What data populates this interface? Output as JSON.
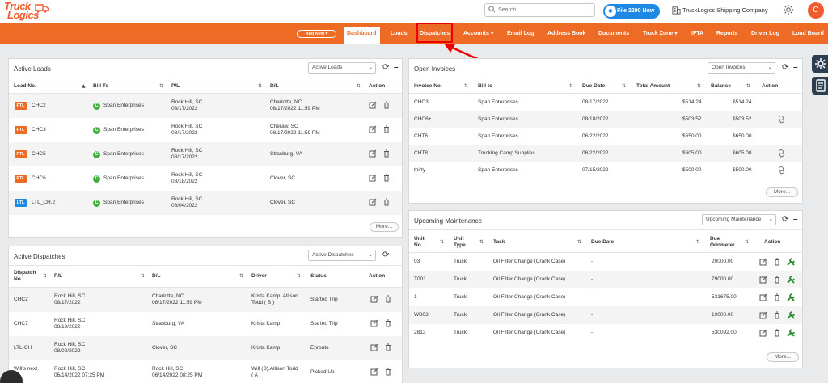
{
  "header": {
    "logo_line1": "Truck",
    "logo_line2": "Logics",
    "search_placeholder": "Search",
    "file_button": "File 2290 Now",
    "company_name": "TruckLogics Shipping Company",
    "avatar_initial": "C"
  },
  "nav": {
    "add_new": "Add New",
    "items": [
      "Dashboard",
      "Loads",
      "Dispatches",
      "Accounts",
      "Email Log",
      "Address Book",
      "Documents",
      "Truck Zone",
      "IFTA",
      "Reports",
      "Driver Log",
      "Load Board"
    ],
    "active": "Dashboard",
    "highlighted": "Dispatches"
  },
  "active_loads": {
    "title": "Active Loads",
    "select": "Active Loads",
    "columns": [
      "Load No.",
      "Bill To",
      "P/L",
      "D/L",
      "Action"
    ],
    "rows": [
      {
        "type": "FTL",
        "load": "CHC2",
        "bill_to": "Span Enterprises",
        "pl_city": "Rock Hill, SC",
        "pl_date": "08/17/2022",
        "dl_city": "Charlotte, NC",
        "dl_date": "08/17/2022 11:59 PM"
      },
      {
        "type": "FTL",
        "load": "CHC3",
        "bill_to": "Span Enterprises",
        "pl_city": "Rock Hill, SC",
        "pl_date": "08/17/2022",
        "dl_city": "Cheraw, SC",
        "dl_date": "08/17/2022 11:59 PM"
      },
      {
        "type": "FTL",
        "load": "CHC5",
        "bill_to": "Span Enterprises",
        "pl_city": "Rock Hill, SC",
        "pl_date": "08/17/2022",
        "dl_city": "Strasburg, VA",
        "dl_date": ""
      },
      {
        "type": "FTL",
        "load": "CHC6",
        "bill_to": "Span Enterprises",
        "pl_city": "Rock Hill, SC",
        "pl_date": "08/18/2022",
        "dl_city": "Clover, SC",
        "dl_date": ""
      },
      {
        "type": "LTL",
        "load": "LTL_CH.2",
        "bill_to": "Span Enterprises",
        "pl_city": "Rock Hill, SC",
        "pl_date": "08/04/2022",
        "dl_city": "Clover, SC",
        "dl_date": ""
      }
    ],
    "more": "More..."
  },
  "active_dispatches": {
    "title": "Active Dispatches",
    "select": "Active Dispatches",
    "columns": [
      "Dispatch No.",
      "P/L",
      "D/L",
      "Driver",
      "Status",
      "Action"
    ],
    "rows": [
      {
        "no": "CHC2",
        "pl_city": "Rock Hill, SC",
        "pl_date": "08/17/2022",
        "dl_city": "Charlotte, NC",
        "dl_date": "08/17/2022 11:59 PM",
        "driver1": "Krista Kamp, Allison",
        "driver2": "Todd ( B )",
        "status": "Started Trip"
      },
      {
        "no": "CHC7",
        "pl_city": "Rock Hill, SC",
        "pl_date": "08/19/2022",
        "dl_city": "Strasburg, VA",
        "dl_date": "",
        "driver1": "Krista Kamp",
        "driver2": "",
        "status": "Started Trip"
      },
      {
        "no": "LTL-CH",
        "pl_city": "Rock Hill, SC",
        "pl_date": "08/02/2022",
        "dl_city": "Clover, SC",
        "dl_date": "",
        "driver1": "Krista Kamp",
        "driver2": "",
        "status": "Enroute"
      },
      {
        "no": "Will's next",
        "pl_city": "Rock Hill, SC",
        "pl_date": "06/14/2022 07:25 PM",
        "dl_city": "Rock Hill, SC",
        "dl_date": "06/14/2022 08:25 PM",
        "driver1": "Will (B),Allison Todd",
        "driver2": "( A )",
        "status": "Picked Up"
      }
    ]
  },
  "open_invoices": {
    "title": "Open Invoices",
    "select": "Open Invoices",
    "columns": [
      "Invoice No.",
      "Bill to",
      "Due Date",
      "Total Amount",
      "Balance",
      "Action"
    ],
    "rows": [
      {
        "no": "CHC3",
        "bill_to": "Span Enterprises",
        "due": "08/17/2022",
        "total": "$514.24",
        "balance": "$514.24",
        "action": false
      },
      {
        "no": "CHC6+",
        "bill_to": "Span Enterprises",
        "due": "08/18/2022",
        "total": "$503.52",
        "balance": "$503.52",
        "action": true
      },
      {
        "no": "CHT6",
        "bill_to": "Span Enterprises",
        "due": "06/22/2022",
        "total": "$650.00",
        "balance": "$650.00",
        "action": false
      },
      {
        "no": "CHT8",
        "bill_to": "Trucking Camp Supplies",
        "due": "06/22/2022",
        "total": "$605.00",
        "balance": "$605.00",
        "action": true
      },
      {
        "no": "thirty",
        "bill_to": "Span Enterprises",
        "due": "07/15/2022",
        "total": "$500.00",
        "balance": "$500.00",
        "action": true
      }
    ],
    "more": "More..."
  },
  "upcoming_maintenance": {
    "title": "Upcoming Maintenance",
    "select": "Upcoming Maintenance",
    "columns": [
      "Unit No.",
      "Unit Type",
      "Task",
      "Due Date",
      "Due Odometer",
      "Action"
    ],
    "col_lines": [
      [
        "Unit",
        "No."
      ],
      [
        "Unit",
        "Type"
      ],
      [
        "Task"
      ],
      [
        "Due Date"
      ],
      [
        "Due",
        "Odometer"
      ],
      [
        "Action"
      ]
    ],
    "rows": [
      {
        "unit": "03",
        "type": "Truck",
        "task": "Oil Filter Change (Crank Case)",
        "due": "-",
        "odometer": "20000.00"
      },
      {
        "unit": "T001",
        "type": "Truck",
        "task": "Oil Filter Change (Crank Case)",
        "due": "-",
        "odometer": "79000.00"
      },
      {
        "unit": "1",
        "type": "Truck",
        "task": "Oil Filter Change (Crank Case)",
        "due": "-",
        "odometer": "531675.00"
      },
      {
        "unit": "WB03",
        "type": "Truck",
        "task": "Oil Filter Change (Crank Case)",
        "due": "-",
        "odometer": "19000.00"
      },
      {
        "unit": "2813",
        "type": "Truck",
        "task": "Oil Filter Change (Crank Case)",
        "due": "-",
        "odometer": "530092.00"
      }
    ],
    "more": "More..."
  },
  "colors": {
    "brand": "#ee6b25",
    "ftl": "#ee6b25",
    "ltl": "#1e88e5",
    "customer": "#3eaf3e",
    "highlight": "#ee0000"
  }
}
